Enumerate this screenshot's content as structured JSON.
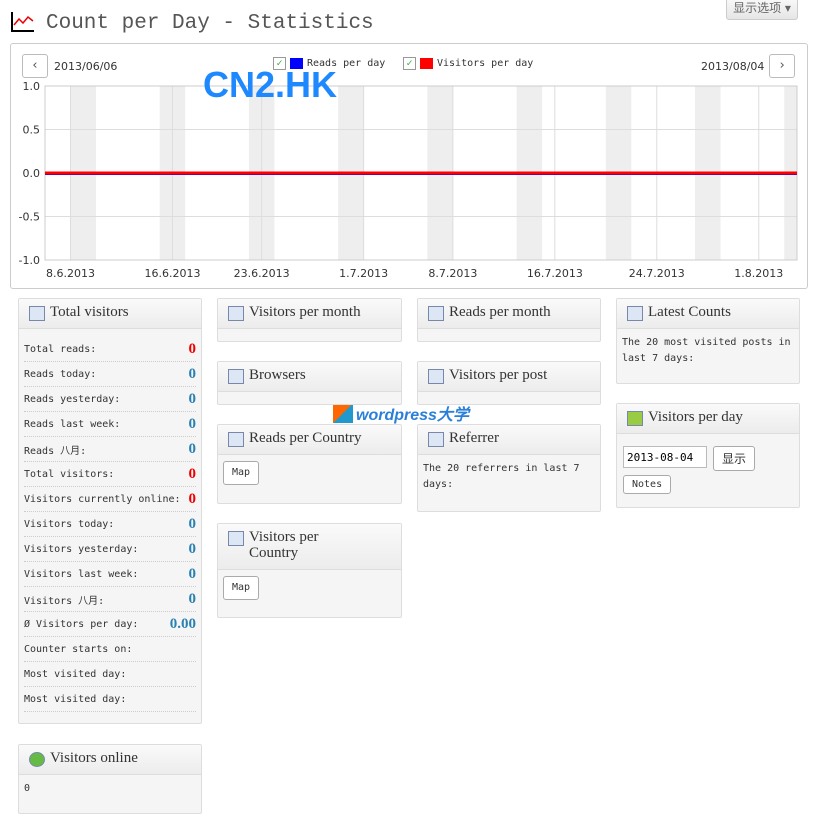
{
  "header": {
    "title": "Count per Day - Statistics",
    "screen_options": "显示选项 ▾"
  },
  "watermarks": {
    "top": "CN2.HK",
    "middle": "wordpress大学"
  },
  "chart": {
    "start_date": "2013/06/06",
    "end_date": "2013/08/04",
    "prev": "‹",
    "next": "›"
  },
  "chart_data": {
    "type": "line",
    "x_range": [
      "2013-06-06",
      "2013-08-04"
    ],
    "ylim": [
      -1,
      1
    ],
    "yticks": [
      "1.0",
      "0.5",
      "0.0",
      "-0.5",
      "-1.0"
    ],
    "xticks": [
      "8.6.2013",
      "16.6.2013",
      "23.6.2013",
      "1.7.2013",
      "8.7.2013",
      "16.7.2013",
      "24.7.2013",
      "1.8.2013"
    ],
    "weekend_shading": true,
    "grid": true,
    "legend": "top-center",
    "series": [
      {
        "name": "Reads per day",
        "color": "#0000ff",
        "checked": true,
        "value_all_days": 0
      },
      {
        "name": "Visitors per day",
        "color": "#ff0000",
        "checked": true,
        "value_all_days": 0
      }
    ]
  },
  "total": {
    "title": "Total visitors",
    "rows": [
      {
        "label": "Total reads:",
        "value": "0",
        "red": true
      },
      {
        "label": "Reads today:",
        "value": "0"
      },
      {
        "label": "Reads yesterday:",
        "value": "0"
      },
      {
        "label": "Reads last week:",
        "value": "0"
      },
      {
        "label": "Reads 八月:",
        "value": "0"
      },
      {
        "label": "Total visitors:",
        "value": "0",
        "red": true
      },
      {
        "label": "Visitors currently online:",
        "value": "0",
        "red": true
      },
      {
        "label": "Visitors today:",
        "value": "0"
      },
      {
        "label": "Visitors yesterday:",
        "value": "0"
      },
      {
        "label": "Visitors last week:",
        "value": "0"
      },
      {
        "label": "Visitors 八月:",
        "value": "0"
      },
      {
        "label": "Ø Visitors per day:",
        "value": "0.00"
      },
      {
        "label": "Counter starts on:",
        "value": ""
      },
      {
        "label": "Most visited day:",
        "value": ""
      },
      {
        "label": "Most visited day:",
        "value": ""
      }
    ]
  },
  "online": {
    "title": "Visitors online",
    "value": "0"
  },
  "vpm": {
    "title": "Visitors per month"
  },
  "browsers": {
    "title": "Browsers"
  },
  "rpc": {
    "title": "Reads per Country",
    "map": "Map"
  },
  "vpc": {
    "title": "Visitors per Country",
    "map": "Map"
  },
  "rpm": {
    "title": "Reads per month"
  },
  "vpp": {
    "title": "Visitors per post"
  },
  "ref": {
    "title": "Referrer",
    "text": "The 20 referrers in last 7 days:"
  },
  "latest": {
    "title": "Latest Counts",
    "text": "The 20 most visited posts in last 7 days:"
  },
  "vpd": {
    "title": "Visitors per day",
    "date": "2013-08-04",
    "show": "显示",
    "notes": "Notes"
  }
}
